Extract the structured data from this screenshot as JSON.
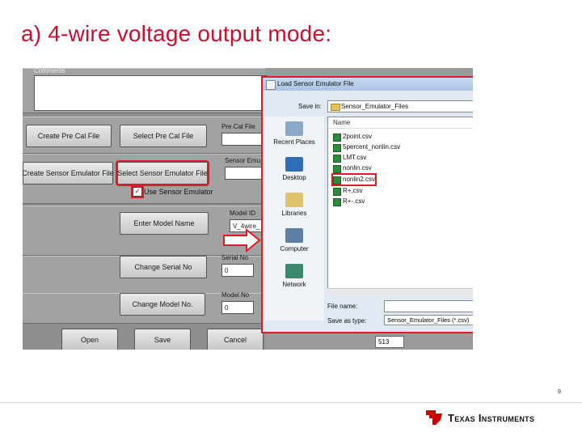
{
  "slide": {
    "title": "a) 4-wire voltage output mode:",
    "page_number": "9"
  },
  "app_panel": {
    "comments_label": "Comments",
    "buttons": {
      "create_pre_cal": "Create Pre Cal File",
      "select_pre_cal": "Select Pre Cal File",
      "create_sensor_emulator": "Create Sensor Emulator File",
      "select_sensor_emulator": "Select Sensor Emulator File",
      "enter_model_name": "Enter Model Name",
      "change_serial_no": "Change Serial No",
      "change_model_no": "Change Model No.",
      "open": "Open",
      "save": "Save",
      "cancel": "Cancel"
    },
    "labels": {
      "pre_cal_file": "Pre Cal File",
      "sensor_emu": "Sensor Emu",
      "model_id": "Model ID",
      "serial_no": "Serial No",
      "model_no": "Model No"
    },
    "fields": {
      "model_id_value": "V_4wire_",
      "serial_no_value": "0",
      "model_no_value": "0",
      "right_value": "513"
    },
    "checkbox": {
      "label": "Use Sensor Emulator",
      "checked": true
    }
  },
  "dialog": {
    "title": "Load Sensor Emulator File",
    "save_in_label": "Save in:",
    "save_in_value": "Sensor_Emulator_Files",
    "places": [
      "Recent Places",
      "Desktop",
      "Libraries",
      "Computer",
      "Network"
    ],
    "column_name": "Name",
    "files": [
      "2point.csv",
      "5percent_nonlin.csv",
      "LMT.csv",
      "nonlin.csv",
      "nonlin2.csv",
      "R+.csv",
      "R+-.csv"
    ],
    "selected_file": "nonlin2.csv",
    "file_name_label": "File name:",
    "save_as_type_label": "Save as type:",
    "save_as_type_value": "Sensor_Emulator_Files (*.csv)"
  },
  "footer": {
    "brand": "Texas Instruments"
  },
  "colors": {
    "title": "#c8102e",
    "highlight": "#e21b23",
    "ti_red": "#cc0000"
  }
}
